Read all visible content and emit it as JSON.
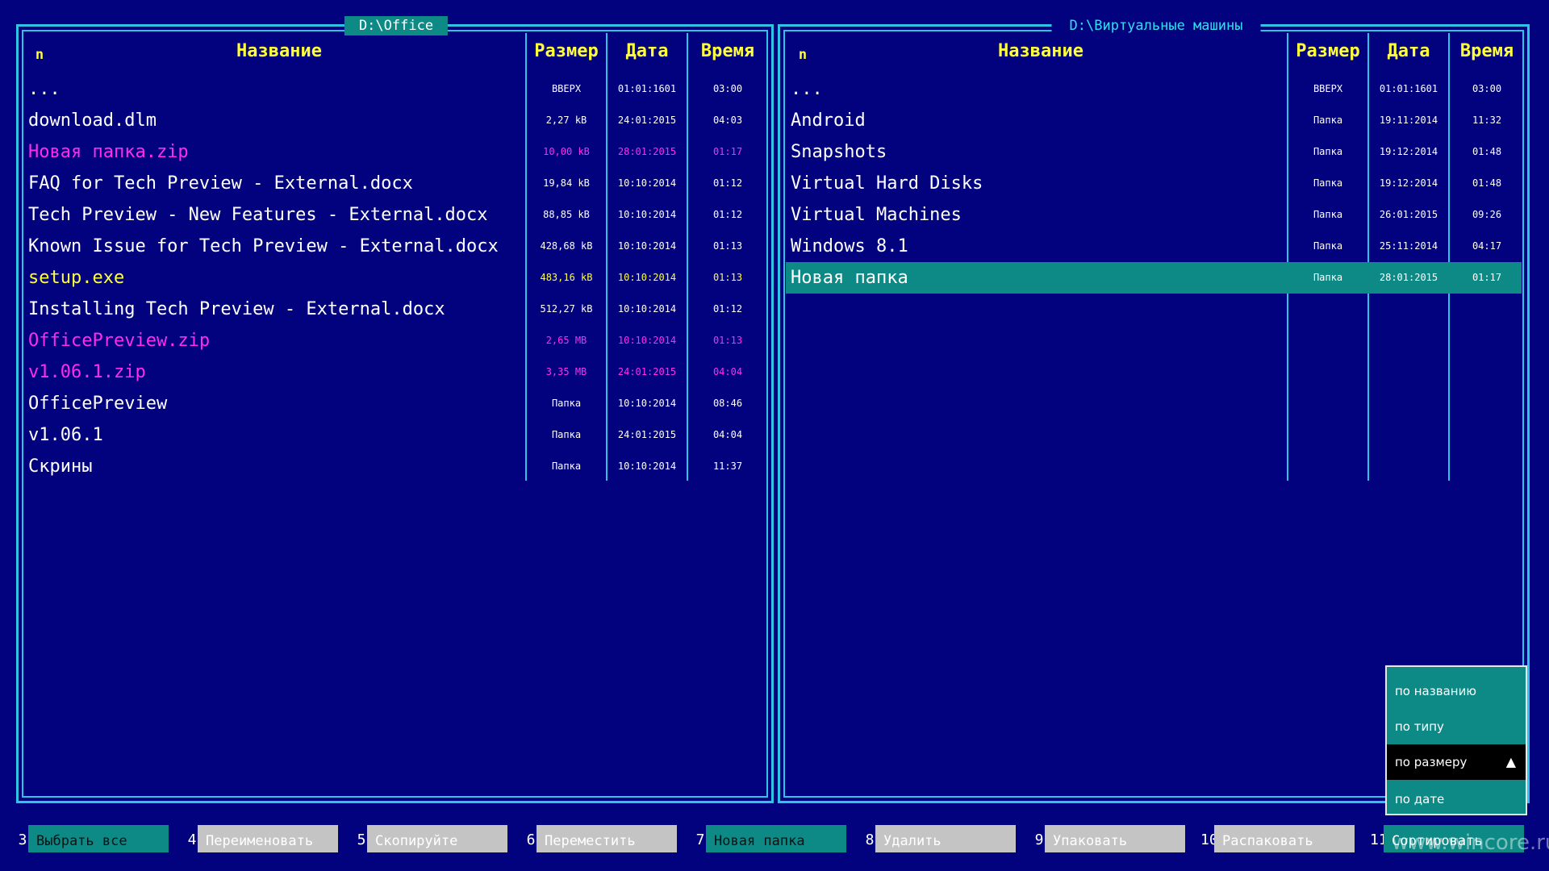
{
  "left_panel": {
    "path": "D:\\Office",
    "headers": {
      "n": "n",
      "name": "Название",
      "size": "Размер",
      "date": "Дата",
      "time": "Время"
    },
    "rows": [
      {
        "name": "...",
        "size": "ВВЕРХ",
        "date": "01:01:1601",
        "time": "03:00",
        "color": "white"
      },
      {
        "name": "download.dlm",
        "size": "2,27 kB",
        "date": "24:01:2015",
        "time": "04:03",
        "color": "white"
      },
      {
        "name": "Новая папка.zip",
        "size": "10,00 kB",
        "date": "28:01:2015",
        "time": "01:17",
        "color": "magenta"
      },
      {
        "name": "FAQ for Tech Preview - External.docx",
        "size": "19,84 kB",
        "date": "10:10:2014",
        "time": "01:12",
        "color": "white"
      },
      {
        "name": "Tech Preview - New Features - External.docx",
        "size": "88,85 kB",
        "date": "10:10:2014",
        "time": "01:12",
        "color": "white"
      },
      {
        "name": "Known Issue for Tech Preview - External.docx",
        "size": "428,68 kB",
        "date": "10:10:2014",
        "time": "01:13",
        "color": "white"
      },
      {
        "name": "setup.exe",
        "size": "483,16 kB",
        "date": "10:10:2014",
        "time": "01:13",
        "color": "yellow"
      },
      {
        "name": "Installing Tech Preview - External.docx",
        "size": "512,27 kB",
        "date": "10:10:2014",
        "time": "01:12",
        "color": "white"
      },
      {
        "name": "OfficePreview.zip",
        "size": "2,65 MB",
        "date": "10:10:2014",
        "time": "01:13",
        "color": "magenta"
      },
      {
        "name": "v1.06.1.zip",
        "size": "3,35 MB",
        "date": "24:01:2015",
        "time": "04:04",
        "color": "magenta"
      },
      {
        "name": "OfficePreview",
        "size": "Папка",
        "date": "10:10:2014",
        "time": "08:46",
        "color": "white"
      },
      {
        "name": "v1.06.1",
        "size": "Папка",
        "date": "24:01:2015",
        "time": "04:04",
        "color": "white"
      },
      {
        "name": "Скрины",
        "size": "Папка",
        "date": "10:10:2014",
        "time": "11:37",
        "color": "white"
      }
    ]
  },
  "right_panel": {
    "path": "D:\\Виртуальные машины",
    "headers": {
      "n": "n",
      "name": "Название",
      "size": "Размер",
      "date": "Дата",
      "time": "Время"
    },
    "rows": [
      {
        "name": "...",
        "size": "ВВЕРХ",
        "date": "01:01:1601",
        "time": "03:00",
        "color": "white"
      },
      {
        "name": "Android",
        "size": "Папка",
        "date": "19:11:2014",
        "time": "11:32",
        "color": "white"
      },
      {
        "name": "Snapshots",
        "size": "Папка",
        "date": "19:12:2014",
        "time": "01:48",
        "color": "white"
      },
      {
        "name": "Virtual Hard Disks",
        "size": "Папка",
        "date": "19:12:2014",
        "time": "01:48",
        "color": "white"
      },
      {
        "name": "Virtual Machines",
        "size": "Папка",
        "date": "26:01:2015",
        "time": "09:26",
        "color": "white"
      },
      {
        "name": "Windows 8.1",
        "size": "Папка",
        "date": "25:11:2014",
        "time": "04:17",
        "color": "white"
      },
      {
        "name": "Новая папка",
        "size": "Папка",
        "date": "28:01:2015",
        "time": "01:17",
        "color": "white",
        "selected": true
      }
    ]
  },
  "function_keys": [
    {
      "num": "3",
      "label": "Выбрать все",
      "style": "teal"
    },
    {
      "num": "4",
      "label": "Переименовать",
      "style": "gray"
    },
    {
      "num": "5",
      "label": "Скопируйте",
      "style": "gray"
    },
    {
      "num": "6",
      "label": "Переместить",
      "style": "gray"
    },
    {
      "num": "7",
      "label": "Новая папка",
      "style": "teal"
    },
    {
      "num": "8",
      "label": "Удалить",
      "style": "gray"
    },
    {
      "num": "9",
      "label": "Упаковать",
      "style": "gray"
    },
    {
      "num": "10",
      "label": "Распаковать",
      "style": "gray"
    },
    {
      "num": "11",
      "label": "Сортировать",
      "style": "teal2"
    }
  ],
  "sort_menu": {
    "options": [
      "по названию",
      "по типу",
      "по размеру",
      "по дате"
    ],
    "active_index": 2,
    "active_icon": "triangle-up-icon",
    "arrow_glyph": "▲"
  },
  "watermark": "www.wincore.ru",
  "colors": {
    "background": "#02027f",
    "border": "#2fc3e8",
    "header_text": "#ffff3a",
    "selection": "#0e8a86",
    "archive": "#ff2cf0",
    "executable": "#ffff3a"
  }
}
